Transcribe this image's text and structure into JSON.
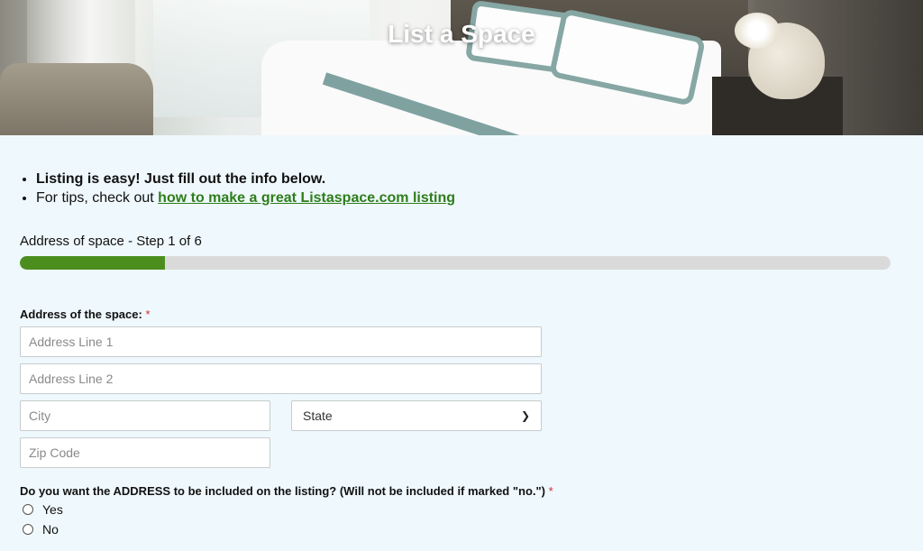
{
  "header": {
    "title": "List a Space"
  },
  "tips": {
    "line1": "Listing is easy! Just fill out the info below.",
    "line2_prefix": "For tips, check out ",
    "line2_link": "how to make a great Listaspace.com listing"
  },
  "progress": {
    "label": "Address of space - Step 1 of 6",
    "current_step": 1,
    "total_steps": 6,
    "fraction": 0.1667,
    "fill_color": "#4b8e1e"
  },
  "address": {
    "label": "Address of the space:",
    "required_mark": "*",
    "line1_placeholder": "Address Line 1",
    "line2_placeholder": "Address Line 2",
    "city_placeholder": "City",
    "state_value": "State",
    "zip_placeholder": "Zip Code"
  },
  "include_address": {
    "question": "Do you want the ADDRESS to be included on the listing? (Will not be included if marked \"no.\")",
    "required_mark": "*",
    "options": [
      "Yes",
      "No"
    ]
  }
}
